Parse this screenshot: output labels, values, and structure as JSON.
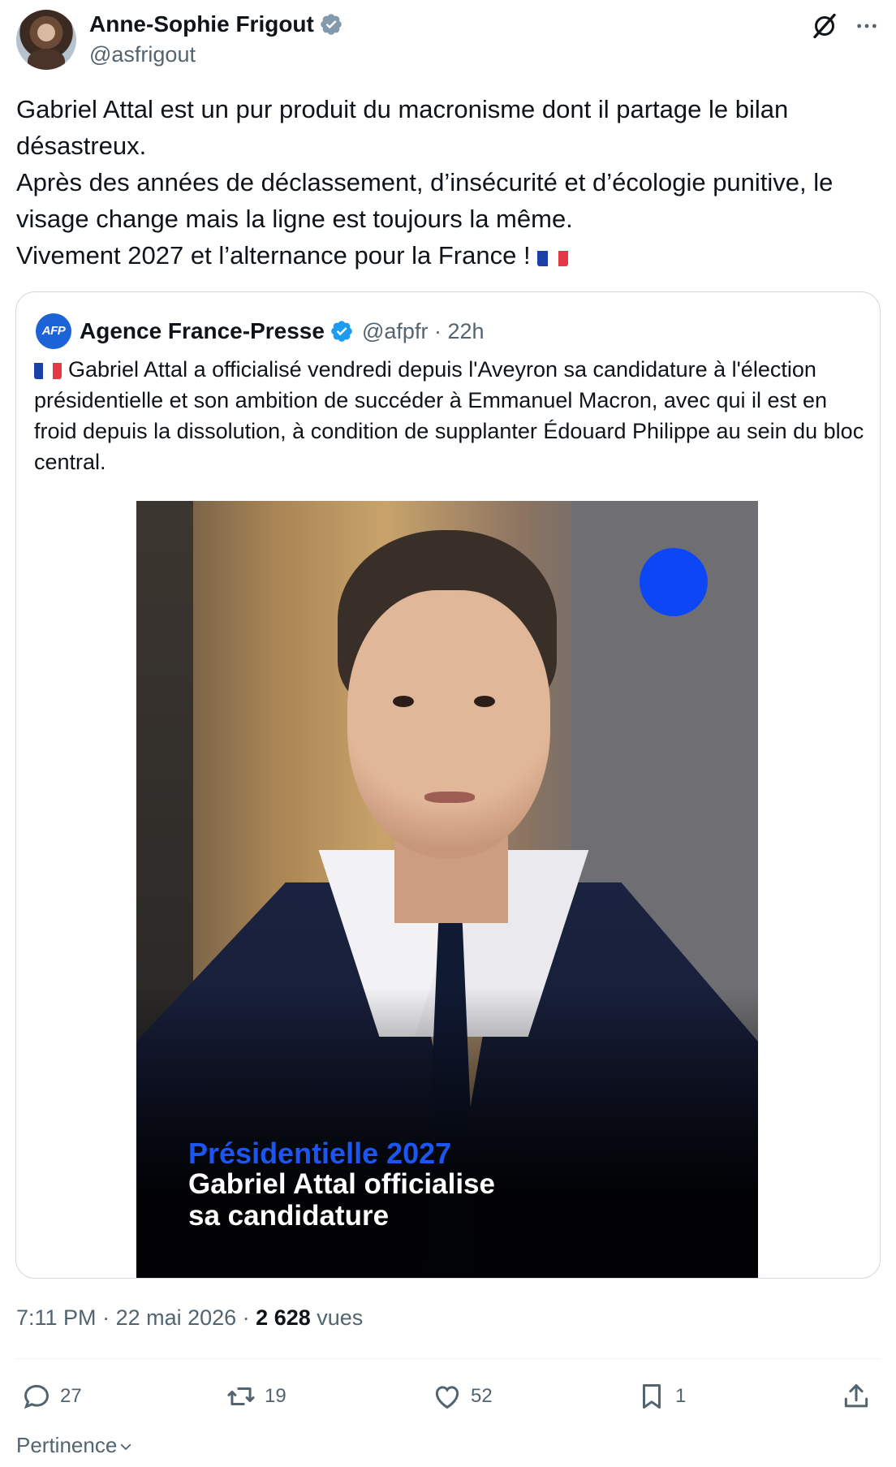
{
  "author": {
    "name": "Anne-Sophie Frigout",
    "handle": "@asfrigout",
    "verified": true
  },
  "tweet": {
    "text": "Gabriel Attal est un pur produit du macronisme dont il partage le bilan désastreux.\nAprès des années de déclassement, d’insécurité et d’écologie punitive, le visage change mais la ligne est toujours la même.\nVivement 2027 et l’alternance pour la France ! "
  },
  "quote": {
    "logo_text": "AFP",
    "name": "Agence France-Presse",
    "handle": "@afpfr",
    "separator": " · ",
    "time": "22h",
    "text": "Gabriel Attal a officialisé vendredi depuis l'Aveyron sa candidature à l'élection présidentielle et son ambition de succéder à Emmanuel Macron, avec qui il est en froid depuis la dissolution, à condition de supplanter Édouard Philippe au sein du bloc central.",
    "media": {
      "caption_title": "Présidentielle 2027",
      "caption_text": "Gabriel Attal officialise\nsa candidature"
    }
  },
  "meta": {
    "time": "7:11 PM",
    "date": "22 mai 2026",
    "views_count": "2 628",
    "views_label": "vues",
    "sep": " · "
  },
  "actions": {
    "replies": "27",
    "reposts": "19",
    "likes": "52",
    "bookmarks": "1"
  },
  "sort": {
    "label": "Pertinence"
  },
  "colors": {
    "text_primary": "#0f1419",
    "text_secondary": "#536471",
    "verified_blue": "#1d9bf0",
    "border": "#cfd9de",
    "afp_blue": "#1d63d8",
    "flag_blue": "#1d3fa8",
    "flag_red": "#e63946"
  },
  "icons": [
    "verified-badge-icon",
    "grok-icon",
    "more-icon",
    "reply-icon",
    "repost-icon",
    "like-icon",
    "bookmark-icon",
    "share-icon",
    "chevron-down-icon",
    "france-flag-icon"
  ]
}
